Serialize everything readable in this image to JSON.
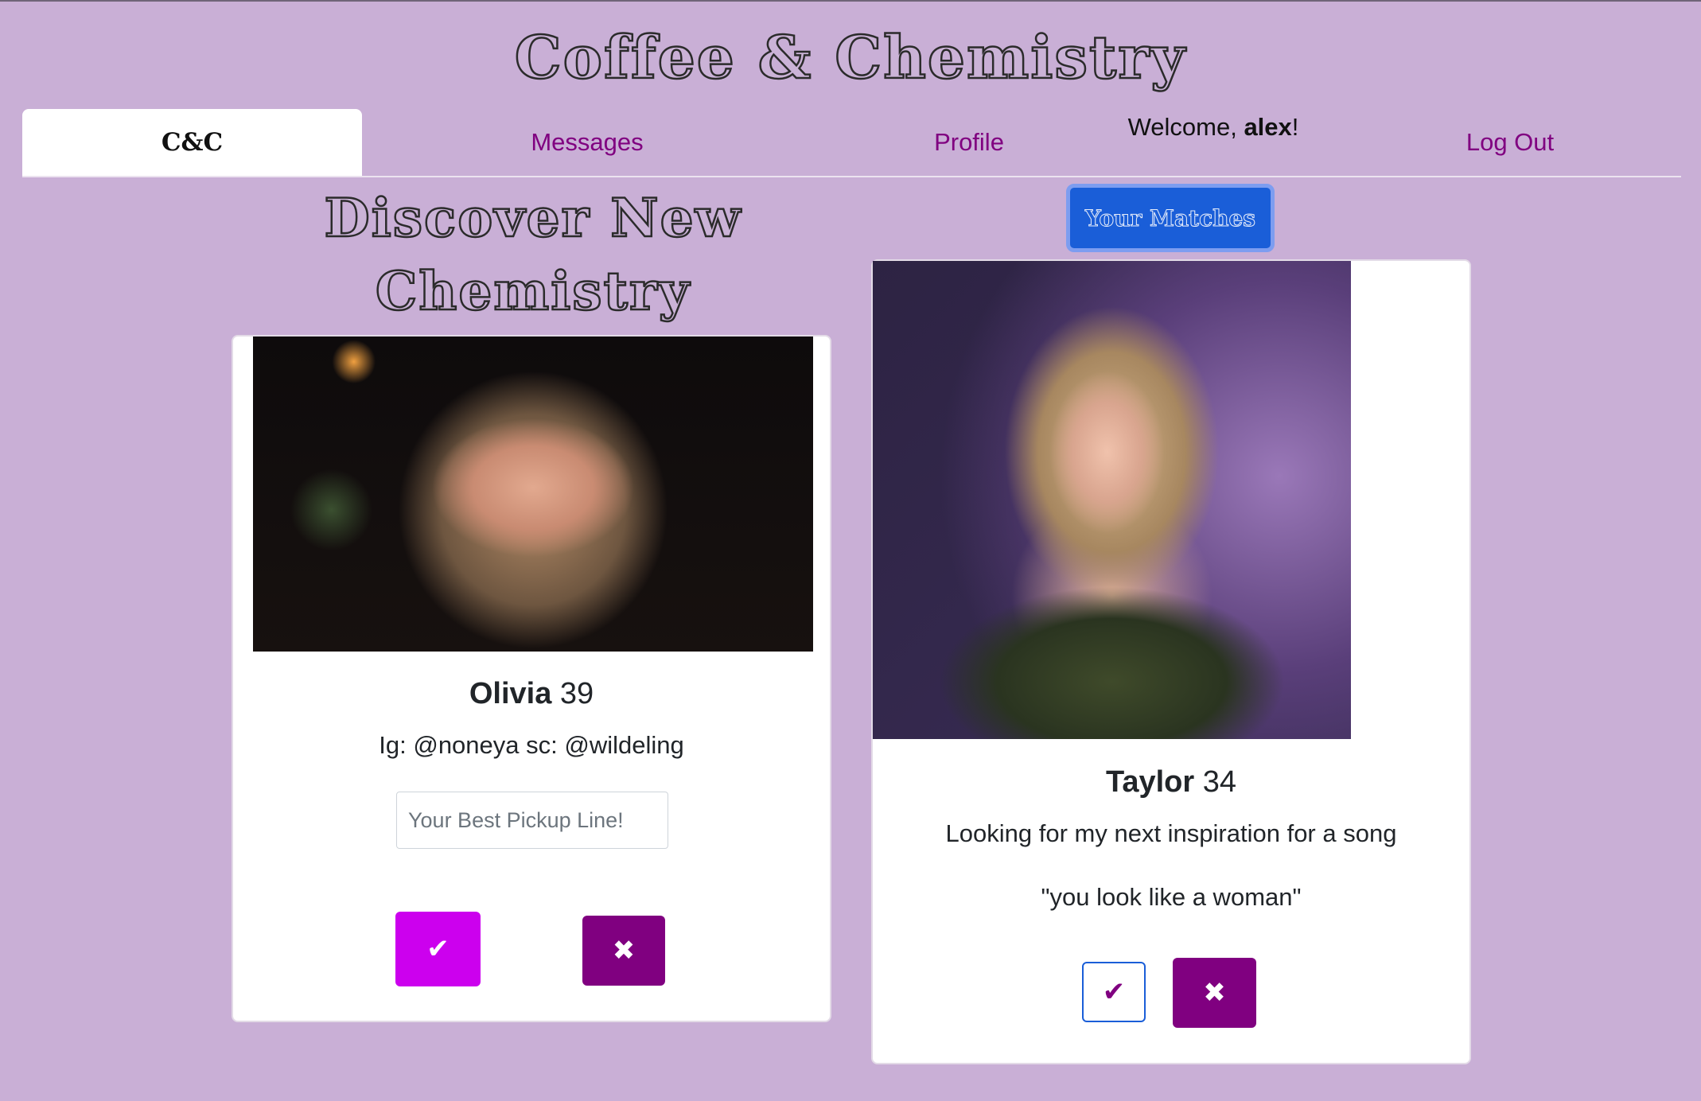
{
  "app": {
    "title": "Coffee & Chemistry"
  },
  "nav": {
    "tabs": [
      {
        "label": "C&C",
        "active": true
      },
      {
        "label": "Messages",
        "active": false
      },
      {
        "label": "Profile",
        "active": false
      },
      {
        "label": "Log Out",
        "active": false
      }
    ],
    "welcome_prefix": "Welcome, ",
    "username": "alex",
    "welcome_suffix": "!"
  },
  "discover": {
    "title": "Discover New Chemistry"
  },
  "matches_button": {
    "label": "Your Matches"
  },
  "candidate": {
    "name": "Olivia",
    "age": "39",
    "bio": "Ig: @noneya sc: @wildeling",
    "pickup_placeholder": "Your Best Pickup Line!",
    "like_icon": "✔",
    "dislike_icon": "✖"
  },
  "match": {
    "name": "Taylor",
    "age": "34",
    "bio": "Looking for my next inspiration for a song",
    "pickup_line": "\"you look like a woman\"",
    "like_icon": "✔",
    "dislike_icon": "✖"
  },
  "colors": {
    "background": "#c9afd6",
    "accent_purple": "#800080",
    "like_magenta": "#cc00ee",
    "primary_blue": "#1a5ed8"
  }
}
